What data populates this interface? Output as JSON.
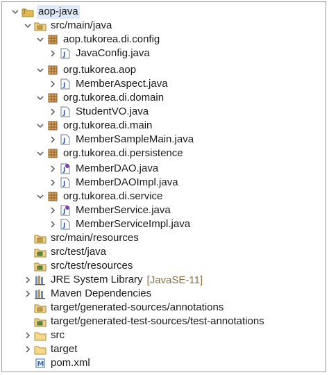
{
  "tree": {
    "project": {
      "label": "aop-java"
    },
    "src_main_java": {
      "label": "src/main/java"
    },
    "pkg_config": {
      "label": "aop.tukorea.di.config"
    },
    "file_javaconfig": {
      "label": "JavaConfig.java"
    },
    "pkg_aop": {
      "label": "org.tukorea.aop"
    },
    "file_memberaspect": {
      "label": "MemberAspect.java"
    },
    "pkg_domain": {
      "label": "org.tukorea.di.domain"
    },
    "file_studentvo": {
      "label": "StudentVO.java"
    },
    "pkg_main": {
      "label": "org.tukorea.di.main"
    },
    "file_membersamplemain": {
      "label": "MemberSampleMain.java"
    },
    "pkg_persistence": {
      "label": "org.tukorea.di.persistence"
    },
    "file_memberdao": {
      "label": "MemberDAO.java"
    },
    "file_memberdaoimpl": {
      "label": "MemberDAOImpl.java"
    },
    "pkg_service": {
      "label": "org.tukorea.di.service"
    },
    "file_memberservice": {
      "label": "MemberService.java"
    },
    "file_memberserviceimpl": {
      "label": "MemberServiceImpl.java"
    },
    "src_main_resources": {
      "label": "src/main/resources"
    },
    "src_test_java": {
      "label": "src/test/java"
    },
    "src_test_resources": {
      "label": "src/test/resources"
    },
    "jre": {
      "label": "JRE System Library",
      "suffix": "[JavaSE-11]"
    },
    "maven": {
      "label": "Maven Dependencies"
    },
    "gen_sources": {
      "label": "target/generated-sources/annotations"
    },
    "gen_test_sources": {
      "label": "target/generated-test-sources/test-annotations"
    },
    "src_folder": {
      "label": "src"
    },
    "target_folder": {
      "label": "target"
    },
    "pom": {
      "label": "pom.xml"
    }
  },
  "colors": {
    "package": "#8a5a2b",
    "source_folder": "#c8a24a",
    "java_file": "#2c5aa0",
    "interface": "#7a3fb0",
    "folder": "#e2b94f",
    "maven": "#3b6bb5"
  }
}
